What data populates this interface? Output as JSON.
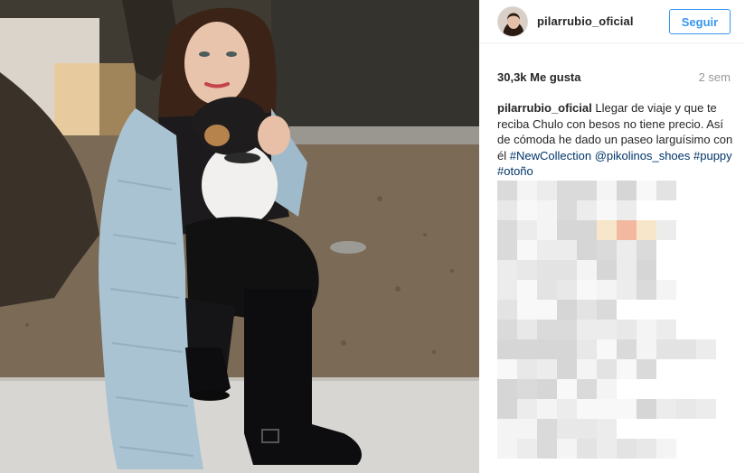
{
  "post": {
    "image_alt": "Photo of a woman crouching outdoors holding a small black and white dog",
    "colors": {
      "follow_blue": "#3897f0",
      "hashtag_blue": "#003569",
      "meta_gray": "#999999"
    }
  },
  "header": {
    "username": "pilarrubio_oficial",
    "follow_label": "Seguir"
  },
  "stats": {
    "likes": "30,3k Me gusta",
    "time_ago": "2 sem"
  },
  "caption": {
    "username": "pilarrubio_oficial",
    "text": " Llegar de viaje y que te reciba Chulo con besos no tiene precio. Así de cómoda he dado un paseo larguísimo con él ",
    "tags": [
      "#NewCollection",
      "@pikolinos_shoes",
      "#puppy",
      "#otoño"
    ]
  }
}
